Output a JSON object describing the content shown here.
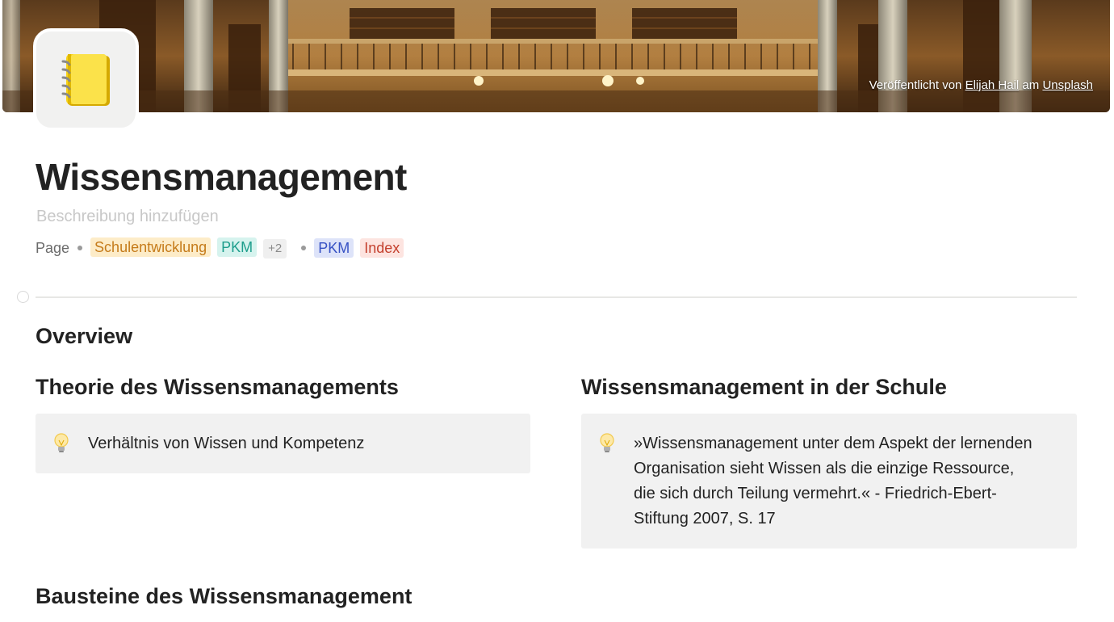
{
  "cover": {
    "credit_prefix": "Veröffentlicht von ",
    "credit_author": "Elijah Hail",
    "credit_middle": " am ",
    "credit_source": "Unsplash"
  },
  "page": {
    "icon": "notebook-icon",
    "title": "Wissensmanagement",
    "description_placeholder": "Beschreibung hinzufügen",
    "type_label": "Page",
    "tags_group1": [
      {
        "label": "Schulentwicklung",
        "bg": "#fdecc8",
        "fg": "#c57b1a"
      },
      {
        "label": "PKM",
        "bg": "#d6f3ee",
        "fg": "#1d9e8c"
      },
      {
        "label": "+2",
        "bg": "#efefef",
        "fg": "#8a8a8a"
      }
    ],
    "tags_group2": [
      {
        "label": "PKM",
        "bg": "#dde3f9",
        "fg": "#3651c4"
      },
      {
        "label": "Index",
        "bg": "#fde4e0",
        "fg": "#c4402e"
      }
    ]
  },
  "content": {
    "overview_heading": "Overview",
    "left_heading": "Theorie des Wissensmanagements",
    "left_callout": "Verhältnis von Wissen und Kompetenz",
    "right_heading": "Wissensmanagement in der Schule",
    "right_callout_lines": [
      "»Wissensmanagement unter dem Aspekt der lernenden",
      "Organisation sieht Wissen als die einzige Ressource,",
      "die sich durch Teilung vermehrt.« - Friedrich-Ebert-",
      "Stiftung 2007, S. 17"
    ],
    "bottom_heading": "Bausteine des Wissensmanagement"
  },
  "colors": {
    "accent_callout_bg": "#f1f1f1",
    "divider": "#e7e7e5",
    "placeholder": "#c8c8c8"
  }
}
